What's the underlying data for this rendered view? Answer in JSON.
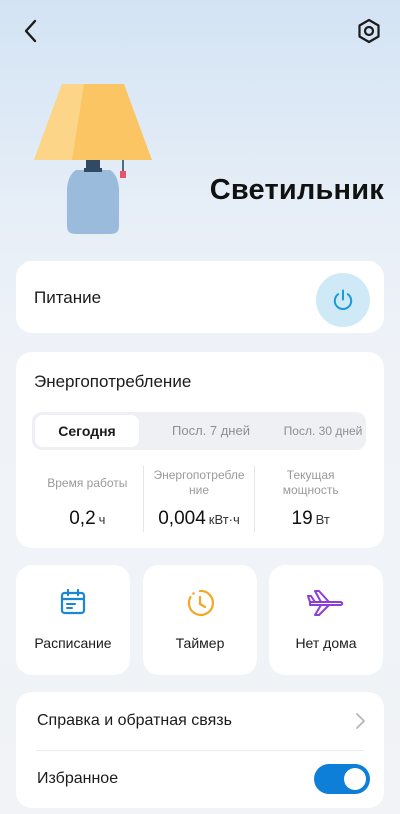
{
  "device": {
    "name": "Светильник"
  },
  "power": {
    "label": "Питание",
    "state": "on"
  },
  "energy": {
    "title": "Энергопотребление",
    "tabs": [
      {
        "label": "Сегодня",
        "active": true
      },
      {
        "label": "Посл. 7 дней",
        "active": false
      },
      {
        "label": "Посл. 30 дней",
        "active": false
      }
    ],
    "stats": [
      {
        "label": "Время работы",
        "value": "0,2",
        "unit": "ч"
      },
      {
        "label": "Энергопотребление",
        "value": "0,004",
        "unit": "кВт·ч"
      },
      {
        "label": "Текущая мощность",
        "value": "19",
        "unit": "Вт"
      }
    ]
  },
  "tiles": [
    {
      "label": "Расписание",
      "icon": "calendar-icon",
      "color": "#1a86d6"
    },
    {
      "label": "Таймер",
      "icon": "clock-icon",
      "color": "#f5a623"
    },
    {
      "label": "Нет дома",
      "icon": "airplane-icon",
      "color": "#8b3fd6"
    }
  ],
  "list": {
    "help_label": "Справка и обратная связь",
    "favorite_label": "Избранное",
    "favorite_enabled": true
  },
  "colors": {
    "accent": "#0e7fd8",
    "power_bg": "#cfe9f7",
    "power_icon": "#1a9ad6"
  }
}
